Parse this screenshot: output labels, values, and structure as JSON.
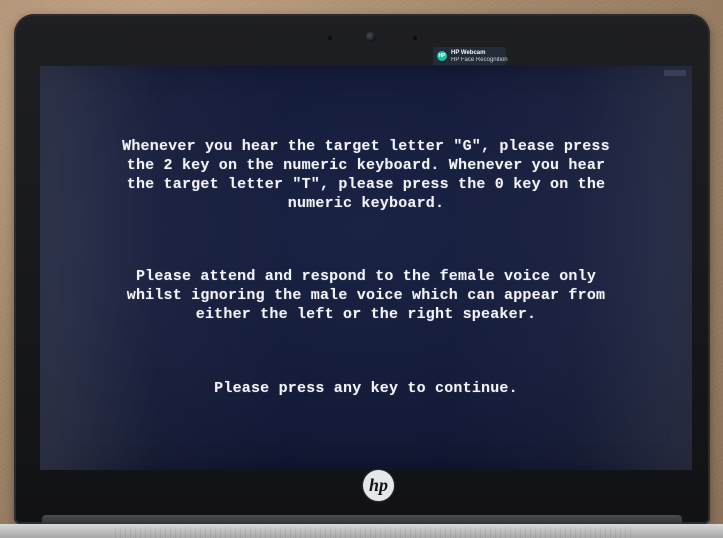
{
  "notification": {
    "title": "HP Webcam",
    "subtitle": "HP Face Recognition",
    "icon": "webcam-app-icon"
  },
  "screen": {
    "paragraphs": [
      "Whenever you hear the target letter \"G\", please press the 2 key on the numeric keyboard. Whenever you hear the target letter \"T\", please press the 0 key on the numeric keyboard.",
      "Please attend and respond to the female voice only whilst ignoring the male voice which can appear from either the left or the right speaker.",
      "Please press any key to continue."
    ]
  },
  "laptop": {
    "logo_text": "hp"
  },
  "colors": {
    "screen_background": "#141b39",
    "text": "#f1f3f7",
    "bezel": "#151619",
    "notification_accent": "#1ec0a1"
  }
}
